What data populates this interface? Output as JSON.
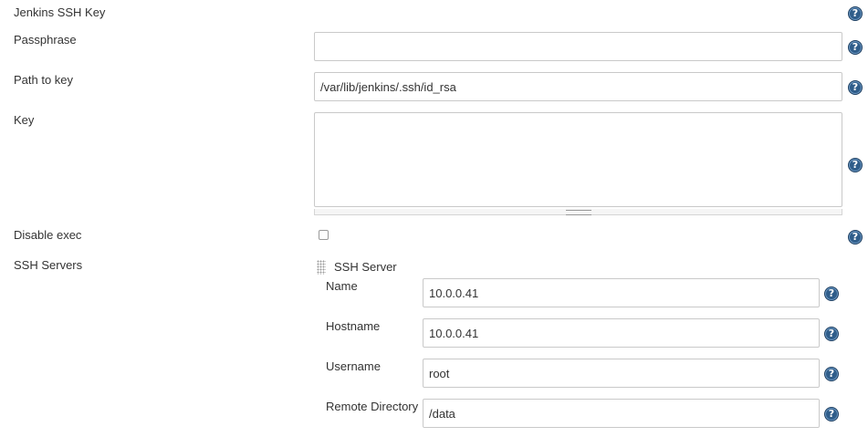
{
  "form": {
    "jenkins_ssh_key_label": "Jenkins SSH Key",
    "passphrase": {
      "label": "Passphrase",
      "value": ""
    },
    "path_to_key": {
      "label": "Path to key",
      "value": "/var/lib/jenkins/.ssh/id_rsa"
    },
    "key": {
      "label": "Key",
      "value": ""
    },
    "disable_exec": {
      "label": "Disable exec",
      "checked": false
    },
    "ssh_servers_label": "SSH Servers",
    "help_glyph": "?",
    "help_icon": "question-circle-icon"
  },
  "ssh_server": {
    "title": "SSH Server",
    "drag_icon": "drag-handle-icon",
    "name": {
      "label": "Name",
      "value": "10.0.0.41"
    },
    "hostname": {
      "label": "Hostname",
      "value": "10.0.0.41"
    },
    "username": {
      "label": "Username",
      "value": "root"
    },
    "remote_directory": {
      "label": "Remote Directory",
      "value": "/data"
    }
  },
  "colors": {
    "help_icon_fill": "#2f5d8a",
    "text": "#333333",
    "input_border": "#c9c9c9"
  }
}
